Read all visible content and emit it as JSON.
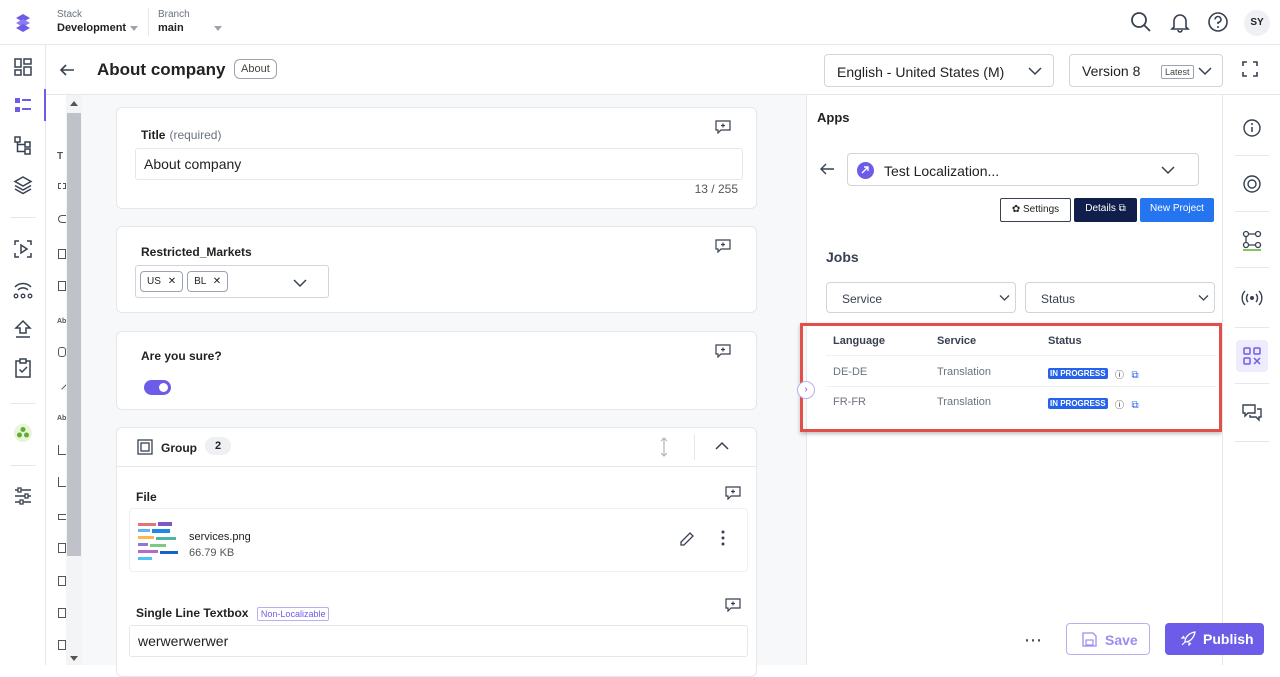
{
  "topbar": {
    "stack_label": "Stack",
    "stack_value": "Development",
    "branch_label": "Branch",
    "branch_value": "main",
    "avatar_initials": "SY"
  },
  "header": {
    "title": "About company",
    "content_type_pill": "About",
    "locale": "English - United States (M)",
    "version": "Version 8",
    "version_badge": "Latest"
  },
  "left_rail_icons": [
    "dashboard-icon",
    "entries-icon",
    "content-models-icon",
    "assets-icon",
    "releases-icon",
    "workflow-icon",
    "deploy-icon",
    "tasks-icon",
    "marketplace-icon",
    "settings-icon"
  ],
  "structure_glyphs": [
    "T",
    "Ab",
    "Ab"
  ],
  "fields": {
    "title": {
      "label": "Title",
      "hint": "(required)",
      "value": "About company",
      "counter": "13 / 255"
    },
    "restricted_markets": {
      "label": "Restricted_Markets",
      "tags": [
        "US",
        "BL"
      ]
    },
    "are_you_sure": {
      "label": "Are you sure?",
      "on": true
    },
    "group": {
      "label": "Group",
      "count": "2",
      "file_label": "File",
      "file_name": "services.png",
      "file_size": "66.79 KB",
      "single_line_label": "Single Line Textbox",
      "single_line_badge": "Non-Localizable",
      "single_line_value": "werwerwerwer"
    }
  },
  "apps_panel": {
    "title": "Apps",
    "app_name": "Test Localization...",
    "settings_button": "Settings",
    "details_button": "Details",
    "new_project_button": "New Project",
    "jobs_heading": "Jobs",
    "filter_service": "Service",
    "filter_status": "Status",
    "table": {
      "headers": [
        "Language",
        "Service",
        "Status"
      ],
      "rows": [
        {
          "language": "DE-DE",
          "service": "Translation",
          "status": "IN PROGRESS"
        },
        {
          "language": "FR-FR",
          "service": "Translation",
          "status": "IN PROGRESS"
        }
      ]
    },
    "highlight_color": "#e0504a"
  },
  "right_rail_icons": [
    "info-icon",
    "focus-icon",
    "workflow-nodes-icon",
    "broadcast-icon",
    "apps-icon",
    "comments-icon"
  ],
  "footer": {
    "more": "⋯",
    "save_label": "Save",
    "publish_label": "Publish"
  },
  "colors": {
    "accent": "#6c5ce7",
    "details_bg": "#0f1e4a",
    "new_project_bg": "#2575f0",
    "status_badge": "#2563eb"
  }
}
